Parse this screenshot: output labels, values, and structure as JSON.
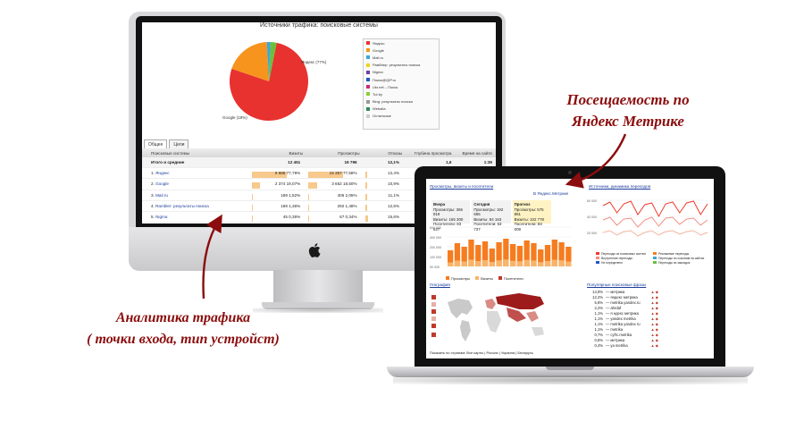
{
  "imac": {
    "report_title": "Источники трафика: поисковые системы",
    "pie_labels": [
      "Яндекс (77%)",
      "Google (18%)"
    ],
    "legend": [
      {
        "label": "Яндекс",
        "color": "#e8322f"
      },
      {
        "label": "Google",
        "color": "#f7941d"
      },
      {
        "label": "Mail.ru",
        "color": "#3aa7d8"
      },
      {
        "label": "Рамблер: результаты поиска",
        "color": "#f5d21b"
      },
      {
        "label": "Nigma",
        "color": "#6c3fa0"
      },
      {
        "label": "Поиск@QIP.ru",
        "color": "#1f57c4"
      },
      {
        "label": "Ukr.net – Поиск",
        "color": "#cc2a74"
      },
      {
        "label": "Tut.by",
        "color": "#8fcb3b"
      },
      {
        "label": "Bing: результаты поиска",
        "color": "#999999"
      },
      {
        "label": "Webalta",
        "color": "#2e8b57"
      },
      {
        "label": "Остальные",
        "color": "#cccccc"
      }
    ],
    "tabs": [
      "Общее",
      "Цели"
    ],
    "table": {
      "headers": [
        "Поисковые системы",
        "Визиты",
        "Просмотры",
        "Отказы",
        "Глубина просмотра",
        "Время на сайте"
      ],
      "total": {
        "label": "Итого и средние",
        "visits": "12 451",
        "views": "19 796",
        "bounces": "12,1%",
        "depth": "1,6",
        "time": "1:39"
      },
      "rows": [
        {
          "num": "1.",
          "name": "Яндекс",
          "visits": "9 686",
          "vpct": "77,79%",
          "views": "15 357",
          "wpct": "77,58%",
          "bounce": "12,4%",
          "vfrac": 0.78,
          "wfrac": 0.78,
          "bfrac": 0.12
        },
        {
          "num": "2.",
          "name": "Google",
          "visits": "2 374",
          "vpct": "19,07%",
          "views": "3 662",
          "wpct": "18,50%",
          "bounce": "10,9%",
          "vfrac": 0.19,
          "wfrac": 0.19,
          "bfrac": 0.11
        },
        {
          "num": "3.",
          "name": "Mail.ru",
          "visits": "189",
          "vpct": "1,52%",
          "views": "406",
          "wpct": "2,05%",
          "bounce": "11,1%",
          "vfrac": 0.02,
          "wfrac": 0.02,
          "bfrac": 0.11
        },
        {
          "num": "4.",
          "name": "Rambler: результаты поиска",
          "visits": "169",
          "vpct": "1,36%",
          "views": "292",
          "wpct": "1,48%",
          "bounce": "12,5%",
          "vfrac": 0.014,
          "wfrac": 0.015,
          "bfrac": 0.125
        },
        {
          "num": "5.",
          "name": "Nigma",
          "visits": "45",
          "vpct": "0,36%",
          "views": "67",
          "wpct": "0,34%",
          "bounce": "15,6%",
          "vfrac": 0.004,
          "wfrac": 0.003,
          "bfrac": 0.156
        },
        {
          "num": "6.",
          "name": "Поиск QIP.ru",
          "visits": "29",
          "vpct": "0,23%",
          "views": "38",
          "wpct": "0,19%",
          "bounce": "10,3%",
          "vfrac": 0.002,
          "wfrac": 0.002,
          "bfrac": 0.103
        }
      ]
    }
  },
  "macbook": {
    "nav_links": [
      "Просмотры, визиты и посетители"
    ],
    "right_link": "Источники, динамика переходов",
    "badge": "В Яндекс.Метрике",
    "stats": [
      {
        "title": "Вчера",
        "lines": [
          "Просмотры: 366 919",
          "Визиты: 165 300",
          "Посетители: 83 627"
        ]
      },
      {
        "title": "Сегодня",
        "lines": [
          "Просмотры: 192 665",
          "Визиты: 84 163",
          "Посетители: 63 737"
        ]
      },
      {
        "title": "Прогноз",
        "lines": [
          "Просмотры: 575 861",
          "Визиты: 102 778",
          "Посетители: 83 008"
        ]
      }
    ],
    "bar_axis": [
      "600 000",
      "400 000",
      "200 000",
      "100 000",
      "50 000"
    ],
    "bar_legend": [
      "Просмотры",
      "Визиты",
      "Посетители"
    ],
    "line_legend": [
      "Переходы из поисковых систем",
      "Рекламные переходы",
      "Внутренние переходы",
      "Переходы по ссылкам на сайтах",
      "Не определено",
      "Переходы из закладок"
    ],
    "line_axis": [
      "60 000",
      "40 000",
      "20 000"
    ],
    "geo_title": "География",
    "geo_footer": "Показать по странам: Все карты | Россия | Украина | Беларусь",
    "phrases_title": "Популярные поисковые фразы",
    "phrases": [
      {
        "pct": "14,9%",
        "text": "метрика"
      },
      {
        "pct": "12,2%",
        "text": "яндекс метрика"
      },
      {
        "pct": "5,8%",
        "text": "metrika.yandex.ru"
      },
      {
        "pct": "2,2%",
        "text": "ahrdaf"
      },
      {
        "pct": "1,1%",
        "text": "я ндекс метрика"
      },
      {
        "pct": "1,1%",
        "text": "yandex metrika"
      },
      {
        "pct": "1,1%",
        "text": "metrika yandex ru"
      },
      {
        "pct": "1,1%",
        "text": "metrika"
      },
      {
        "pct": "0,7%",
        "text": "cyfrc.metrika"
      },
      {
        "pct": "0,6%",
        "text": "метрика"
      },
      {
        "pct": "0,4%",
        "text": "ya metrika"
      }
    ],
    "metrika_colors": {
      "bar": "#f57c1f",
      "line": "#ef3b2c",
      "map": "#9e1b1b"
    }
  },
  "captions": {
    "top": [
      "Посещаемость по",
      "Яндекс Метрике"
    ],
    "bottom": [
      "Аналитика трафика",
      "( точки входа, тип устройст)"
    ],
    "color": "#8b0d0d"
  },
  "pie": [
    {
      "label": "Яндекс",
      "value": 77,
      "color": "#e8322f"
    },
    {
      "label": "Google",
      "value": 19,
      "color": "#f7941d"
    },
    {
      "label": "Mail.ru",
      "value": 1.5,
      "color": "#3aa7d8"
    },
    {
      "label": "Прочие",
      "value": 2.5,
      "color": "#6cbf3b"
    }
  ]
}
